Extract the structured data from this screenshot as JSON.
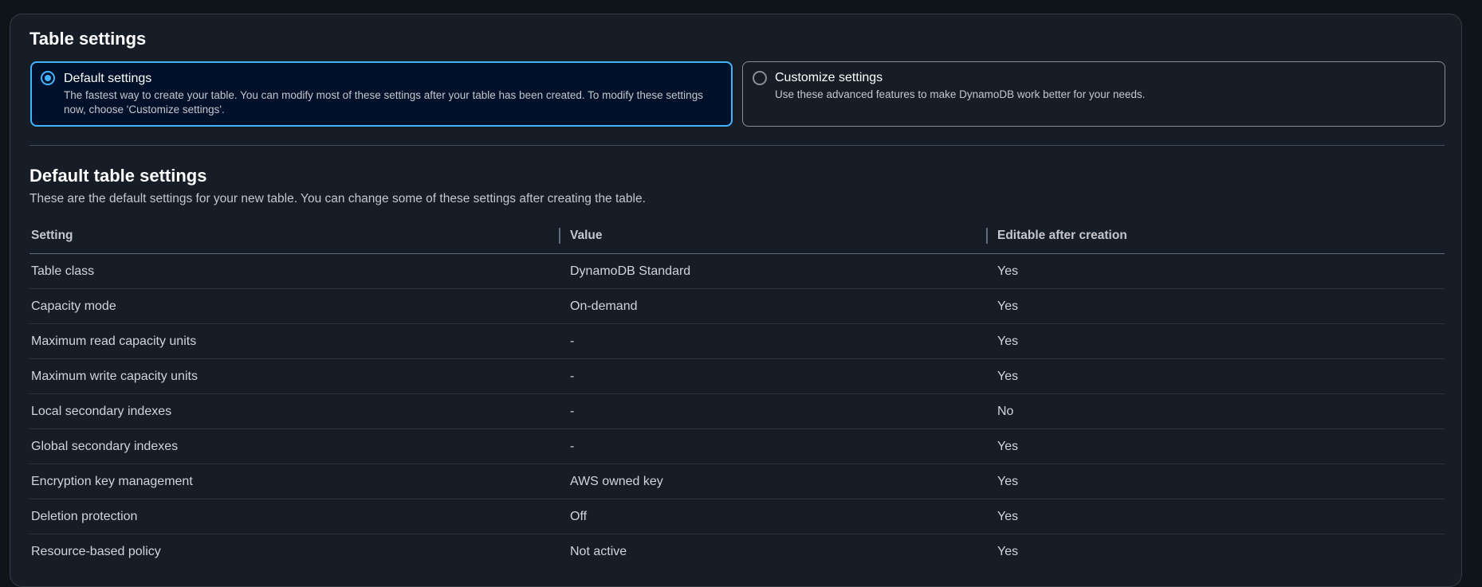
{
  "table_settings": {
    "title": "Table settings",
    "options": [
      {
        "label": "Default settings",
        "description": "The fastest way to create your table. You can modify most of these settings after your table has been created. To modify these settings now, choose 'Customize settings'.",
        "selected": true
      },
      {
        "label": "Customize settings",
        "description": "Use these advanced features to make DynamoDB work better for your needs.",
        "selected": false
      }
    ]
  },
  "default_table_settings": {
    "title": "Default table settings",
    "description": "These are the default settings for your new table. You can change some of these settings after creating the table.",
    "columns": [
      "Setting",
      "Value",
      "Editable after creation"
    ],
    "rows": [
      [
        "Table class",
        "DynamoDB Standard",
        "Yes"
      ],
      [
        "Capacity mode",
        "On-demand",
        "Yes"
      ],
      [
        "Maximum read capacity units",
        "-",
        "Yes"
      ],
      [
        "Maximum write capacity units",
        "-",
        "Yes"
      ],
      [
        "Local secondary indexes",
        "-",
        "No"
      ],
      [
        "Global secondary indexes",
        "-",
        "Yes"
      ],
      [
        "Encryption key management",
        "AWS owned key",
        "Yes"
      ],
      [
        "Deletion protection",
        "Off",
        "Yes"
      ],
      [
        "Resource-based policy",
        "Not active",
        "Yes"
      ]
    ]
  },
  "colors": {
    "accent": "#42b4ff",
    "background": "#161d26",
    "selected_tile_bg": "#001129"
  }
}
